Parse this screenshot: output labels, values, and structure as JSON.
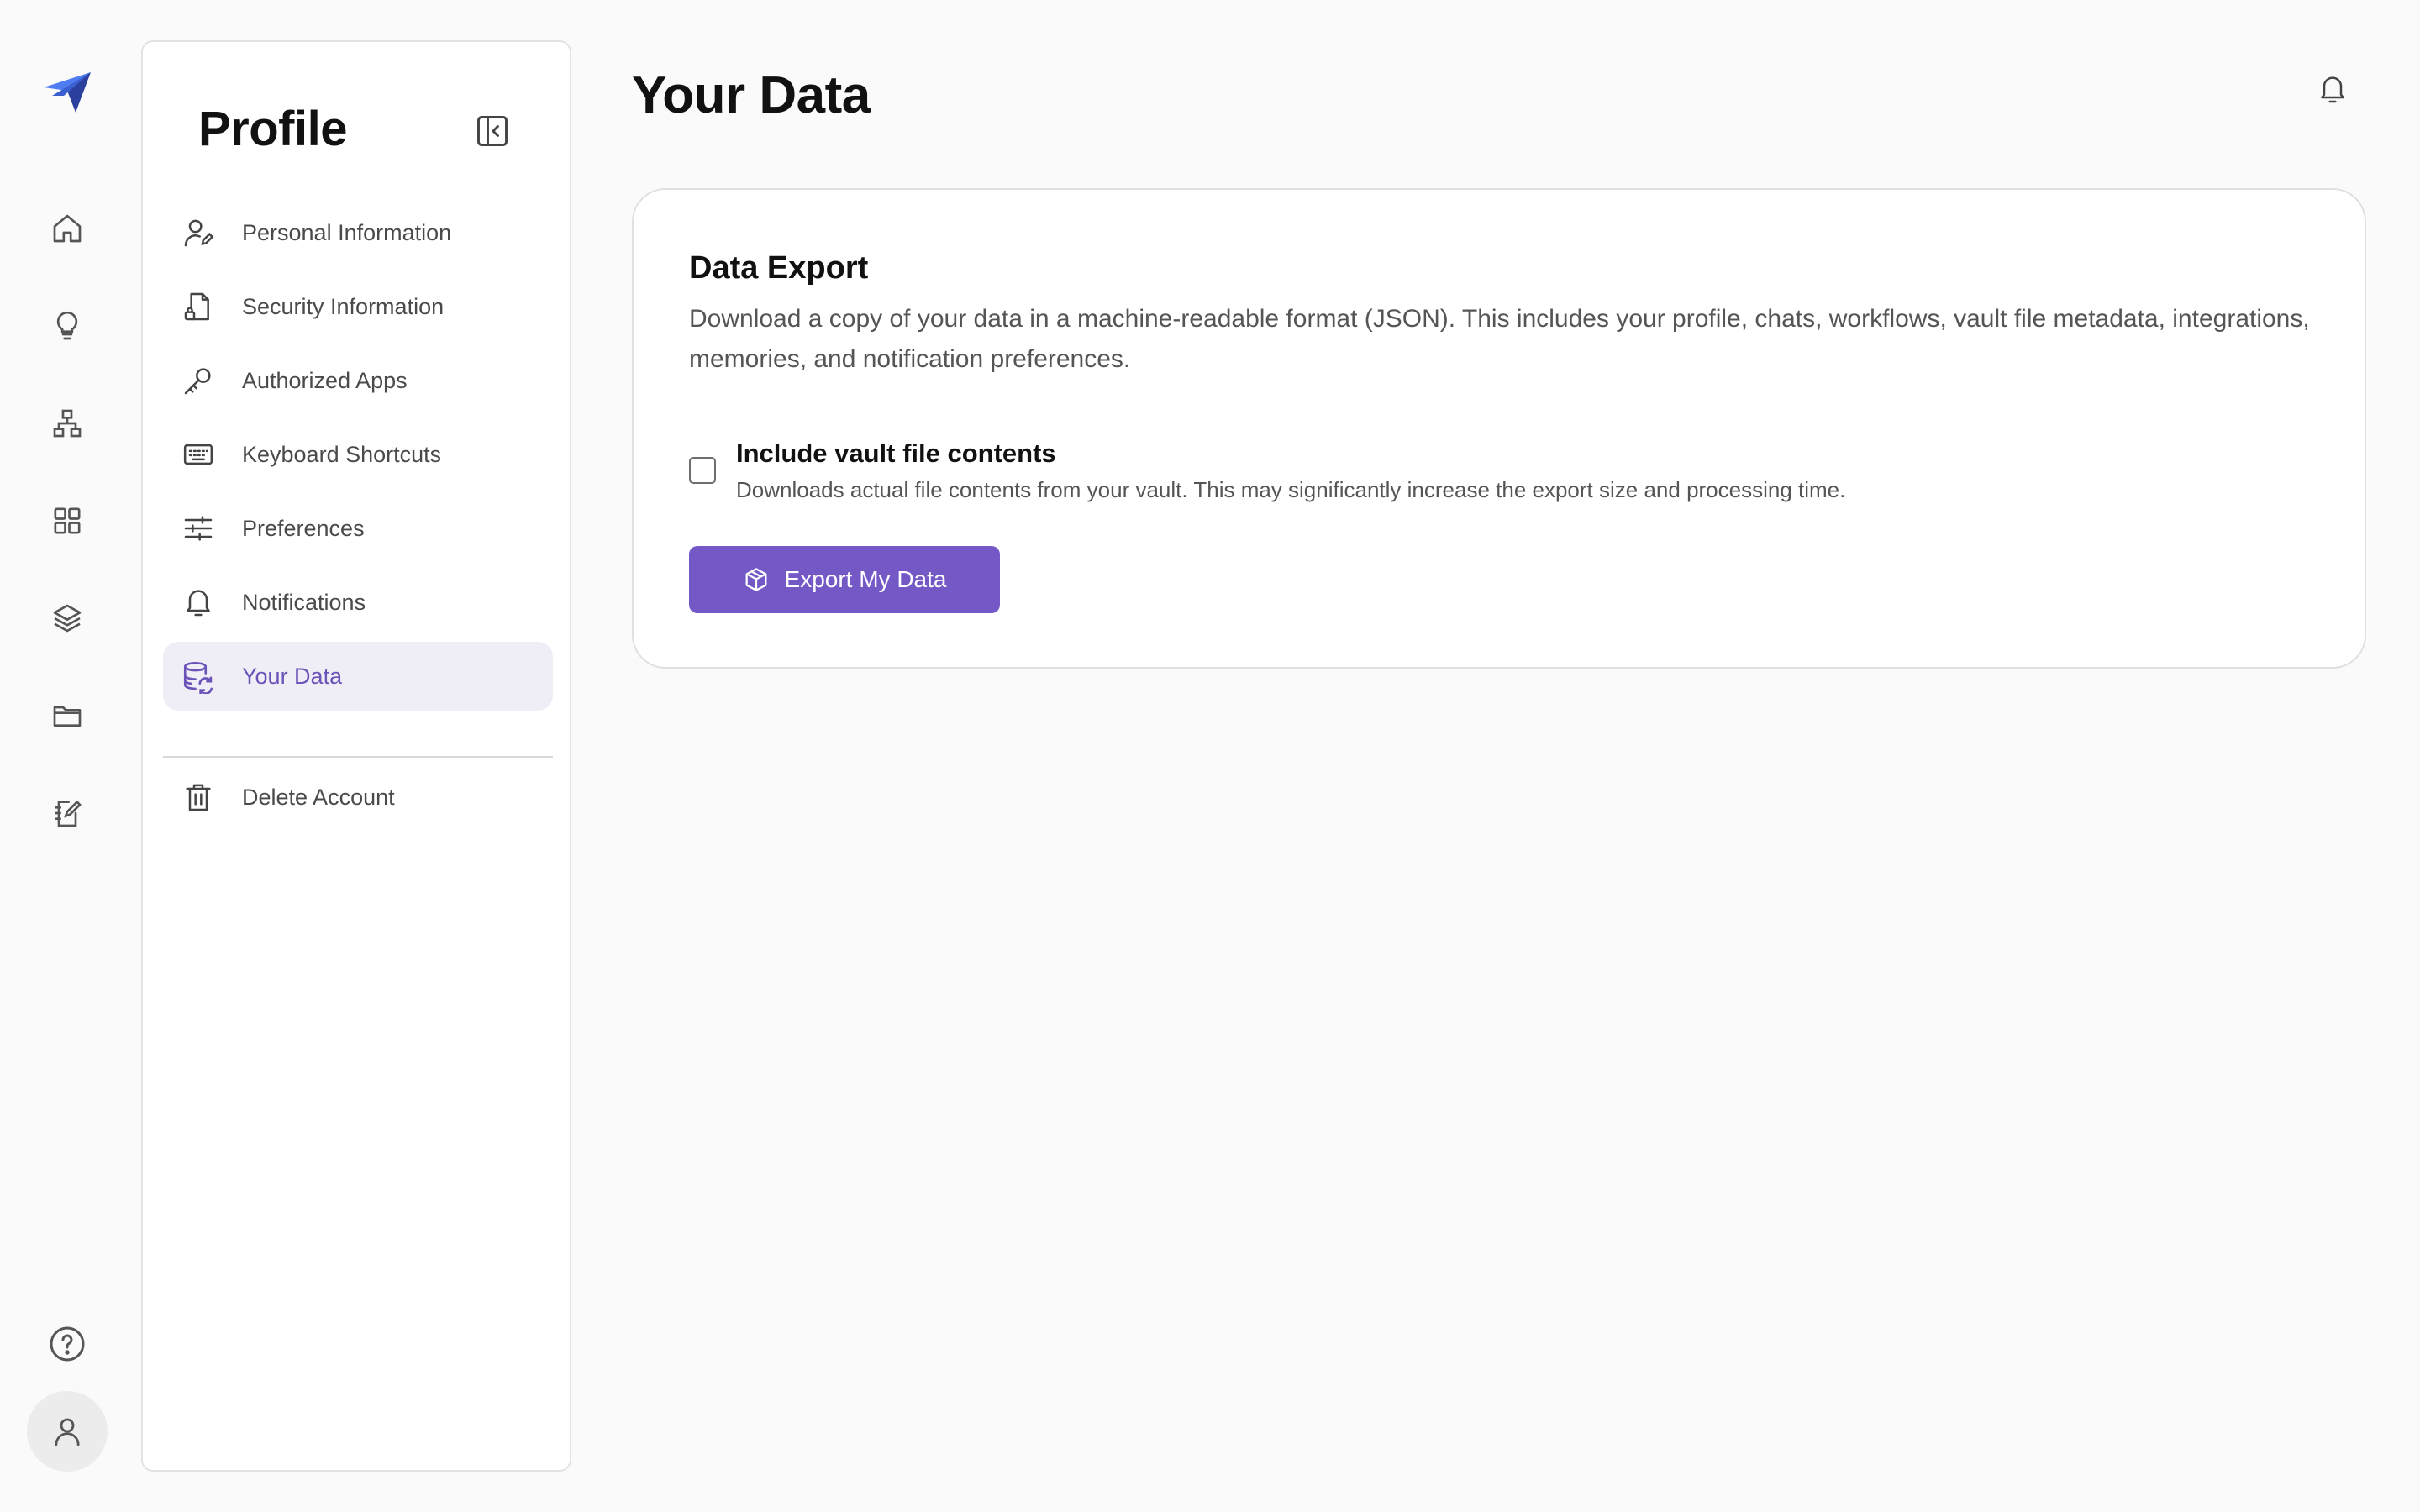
{
  "rail": {
    "items": [
      {
        "name": "home-icon"
      },
      {
        "name": "lightbulb-icon"
      },
      {
        "name": "org-chart-icon"
      },
      {
        "name": "apps-grid-icon"
      },
      {
        "name": "layers-icon"
      },
      {
        "name": "folder-icon"
      },
      {
        "name": "notebook-edit-icon"
      }
    ],
    "help_icon": "help-circle-icon",
    "avatar_icon": "user-icon"
  },
  "sidebar": {
    "title": "Profile",
    "items": [
      {
        "label": "Personal Information",
        "icon": "user-pen-icon"
      },
      {
        "label": "Security Information",
        "icon": "file-lock-icon"
      },
      {
        "label": "Authorized Apps",
        "icon": "key-icon"
      },
      {
        "label": "Keyboard Shortcuts",
        "icon": "keyboard-icon"
      },
      {
        "label": "Preferences",
        "icon": "sliders-icon"
      },
      {
        "label": "Notifications",
        "icon": "bell-icon"
      },
      {
        "label": "Your Data",
        "icon": "database-refresh-icon",
        "active": true
      }
    ],
    "danger_item": {
      "label": "Delete Account",
      "icon": "trash-icon"
    }
  },
  "main": {
    "title": "Your Data",
    "card": {
      "title": "Data Export",
      "description": "Download a copy of your data in a machine-readable format (JSON). This includes your profile, chats, workflows, vault file metadata, integrations, memories, and notification preferences.",
      "checkbox_label": "Include vault file contents",
      "checkbox_help": "Downloads actual file contents from your vault. This may significantly increase the export size and processing time.",
      "checkbox_checked": false,
      "button_label": "Export My Data"
    }
  },
  "colors": {
    "accent": "#7358c6",
    "active_bg": "#efedf6",
    "active_text": "#6b53b8",
    "logo_dark": "#2a3f9e",
    "logo_light": "#4f7cf0"
  }
}
